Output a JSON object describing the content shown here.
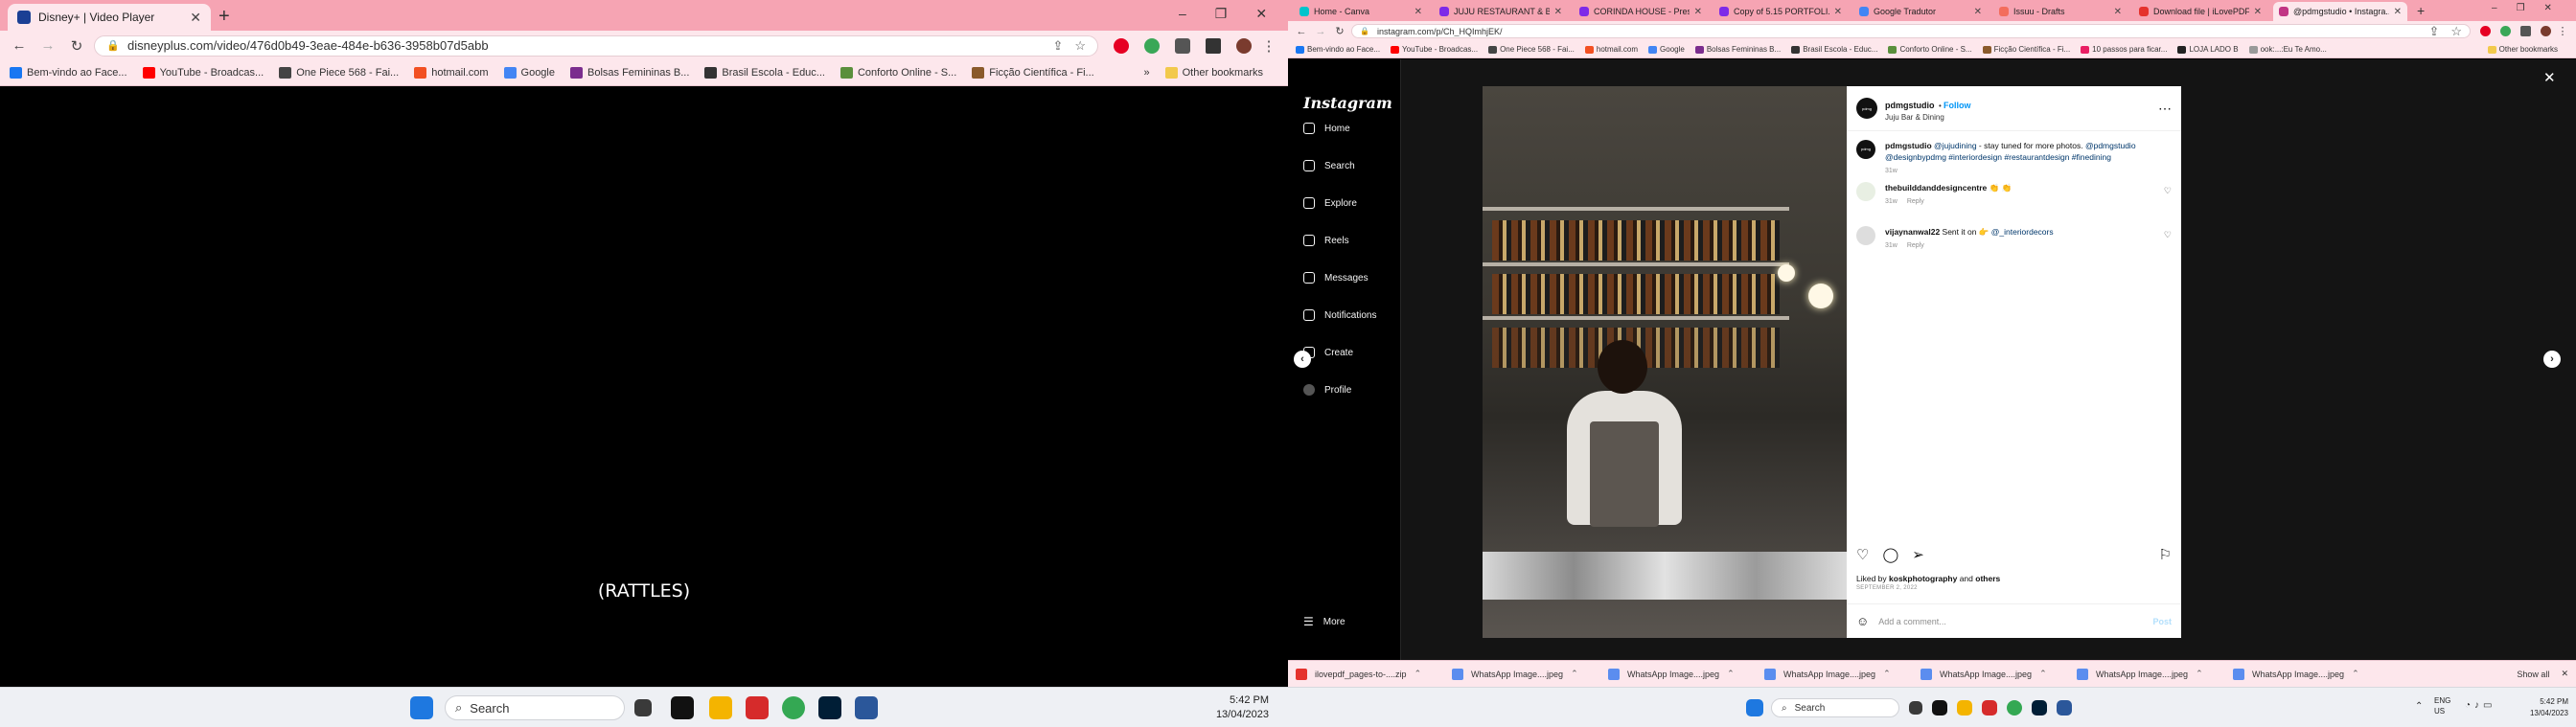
{
  "left_browser": {
    "tab": {
      "title": "Disney+ | Video Player",
      "close": "✕"
    },
    "new_tab": "+",
    "url": "disneyplus.com/video/476d0b49-3eae-484e-b636-3958b07d5abb",
    "bookmarks": [
      {
        "label": "Bem-vindo ao Face...",
        "color": "#1877f2"
      },
      {
        "label": "YouTube - Broadcas...",
        "color": "#ff0000"
      },
      {
        "label": "One Piece 568 - Fai...",
        "color": "#444444"
      },
      {
        "label": "hotmail.com",
        "color": "#f25022"
      },
      {
        "label": "Google",
        "color": "#4285f4"
      },
      {
        "label": "Bolsas Femininas B...",
        "color": "#7b2d8e"
      },
      {
        "label": "Brasil Escola - Educ...",
        "color": "#333333"
      },
      {
        "label": "Conforto Online - S...",
        "color": "#5a8f3c"
      },
      {
        "label": "Ficção Científica - Fi...",
        "color": "#8a5a2b"
      }
    ],
    "more": "»",
    "other_bookmarks": "Other bookmarks",
    "caption": "(RATTLES)"
  },
  "left_taskbar": {
    "search": "Search",
    "time": "5:42 PM",
    "date": "13/04/2023"
  },
  "right_browser": {
    "tabs": [
      {
        "title": "Home - Canva",
        "color": "#00c4cc"
      },
      {
        "title": "JUJU RESTAURANT & BA...",
        "color": "#7d2ae8"
      },
      {
        "title": "CORINDA HOUSE - Preso...",
        "color": "#7d2ae8"
      },
      {
        "title": "Copy of 5.15 PORTFOLI...",
        "color": "#7d2ae8"
      },
      {
        "title": "Google Tradutor",
        "color": "#4285f4"
      },
      {
        "title": "Issuu - Drafts",
        "color": "#f36d5d"
      },
      {
        "title": "Download file | iLovePDF",
        "color": "#e5322d"
      },
      {
        "title": "@pdmgstudio • Instagra...",
        "color": "#c13584"
      }
    ],
    "url": "instagram.com/p/Ch_HQImhjEK/",
    "bookmarks": [
      {
        "label": "Bem-vindo ao Face...",
        "color": "#1877f2"
      },
      {
        "label": "YouTube - Broadcas...",
        "color": "#ff0000"
      },
      {
        "label": "One Piece 568 - Fai...",
        "color": "#444444"
      },
      {
        "label": "hotmail.com",
        "color": "#f25022"
      },
      {
        "label": "Google",
        "color": "#4285f4"
      },
      {
        "label": "Bolsas Femininas B...",
        "color": "#7b2d8e"
      },
      {
        "label": "Brasil Escola - Educ...",
        "color": "#333333"
      },
      {
        "label": "Conforto Online - S...",
        "color": "#5a8f3c"
      },
      {
        "label": "Ficção Científica - Fi...",
        "color": "#8a5a2b"
      },
      {
        "label": "10 passos para ficar...",
        "color": "#e91e63"
      },
      {
        "label": "LOJA LADO B",
        "color": "#222222"
      },
      {
        "label": "ook:...:Eu Te Amo...",
        "color": "#999999"
      }
    ],
    "other_bookmarks": "Other bookmarks"
  },
  "instagram": {
    "logo": "Instagram",
    "nav": [
      "Home",
      "Search",
      "Explore",
      "Reels",
      "Messages",
      "Notifications",
      "Create",
      "Profile"
    ],
    "more": "More",
    "close": "✕",
    "post": {
      "username": "pdmgstudio",
      "follow": "Follow",
      "location": "Juju Bar & Dining",
      "avatar_text": "pdmg",
      "caption_user": "pdmgstudio",
      "caption_mention": "@jujudining",
      "caption_text": " - stay tuned for more photos.",
      "caption_tags": "@pdmgstudio @designbypdmg #interiordesign #restaurantdesign #finedining",
      "caption_age": "31w",
      "comments": [
        {
          "user": "thebuilddanddesigncentre",
          "text": " 👏 👏",
          "age": "31w",
          "reply": "Reply"
        },
        {
          "user": "vijaynanwal22",
          "text": " Sent it on 👉 ",
          "mention": "@_interiordecors",
          "age": "31w",
          "reply": "Reply"
        }
      ],
      "liked_prefix": "Liked by ",
      "liked_user": "koskphotography",
      "liked_mid": " and ",
      "liked_others": "others",
      "date": "SEPTEMBER 2, 2022",
      "add_comment": "Add a comment...",
      "post_btn": "Post"
    }
  },
  "downloads": {
    "items": [
      "ilovepdf_pages-to-....zip",
      "WhatsApp Image....jpeg",
      "WhatsApp Image....jpeg",
      "WhatsApp Image....jpeg",
      "WhatsApp Image....jpeg",
      "WhatsApp Image....jpeg",
      "WhatsApp Image....jpeg"
    ],
    "show_all": "Show all"
  },
  "right_taskbar": {
    "search": "Search",
    "lang": "ENG",
    "region": "US",
    "time": "5:42 PM",
    "date": "13/04/2023"
  }
}
